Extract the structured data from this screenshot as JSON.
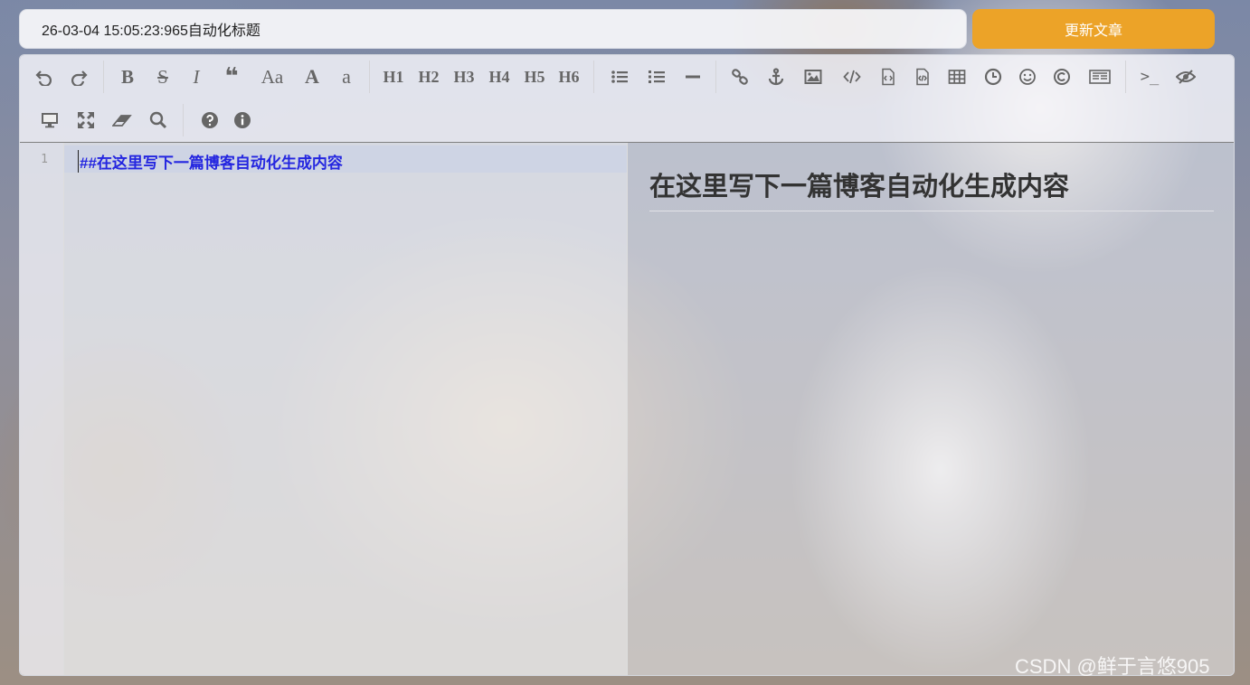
{
  "header": {
    "title_value": "26-03-04 15:05:23:965自动化标题",
    "update_button": "更新文章"
  },
  "toolbar": {
    "bold": "B",
    "strikethrough": "S",
    "italic": "I",
    "quote": "❝",
    "uppercase_first": "Aa",
    "uppercase": "A",
    "lowercase": "a",
    "h1": "H1",
    "h2": "H2",
    "h3": "H3",
    "h4": "H4",
    "h5": "H5",
    "h6": "H6",
    "terminal": ">_"
  },
  "editor": {
    "line_number": "1",
    "line_content": "##在这里写下一篇博客自动化生成内容"
  },
  "preview": {
    "heading": "在这里写下一篇博客自动化生成内容"
  },
  "watermark": "CSDN @鲜于言悠905",
  "colors": {
    "accent": "#eca328",
    "code_text": "#2426e0",
    "icon": "#666666"
  }
}
